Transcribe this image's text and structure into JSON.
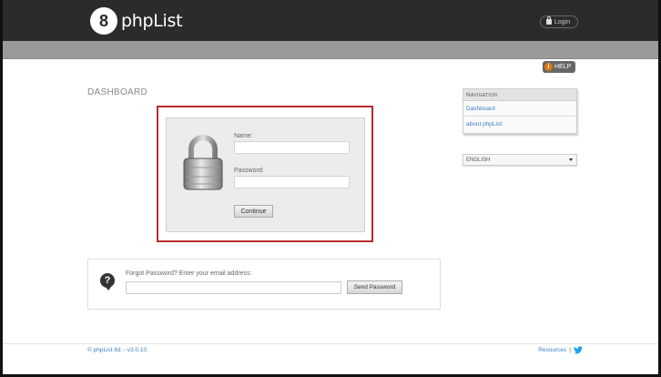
{
  "header": {
    "brand": "phpList",
    "logo_glyph": "8",
    "login_label": "Login",
    "bg_color": "#2b2b2b"
  },
  "help": {
    "label": "HELP",
    "icon_glyph": "i",
    "icon": "info-icon"
  },
  "page": {
    "title": "DASHBOARD"
  },
  "login_form": {
    "name_label": "Name:",
    "name_value": "",
    "password_label": "Password:",
    "password_value": "",
    "continue_label": "Continue",
    "icon": "padlock-icon",
    "highlight_color": "#b52d2d"
  },
  "forgot": {
    "label": "Forgot Password? Enter your email address:",
    "email_value": "",
    "send_label": "Send Password",
    "icon_glyph": "?",
    "icon": "question-bubble-icon"
  },
  "navigation": {
    "heading": "Navigation",
    "items": [
      {
        "label": "Dashboard"
      },
      {
        "label": "about phpList"
      }
    ]
  },
  "language": {
    "selected": "ENGLISH"
  },
  "footer": {
    "copyright": "© phpList ltd. - v3.0.10",
    "resources_label": "Resources",
    "separator": "|",
    "link_color": "#3a7fc1"
  }
}
